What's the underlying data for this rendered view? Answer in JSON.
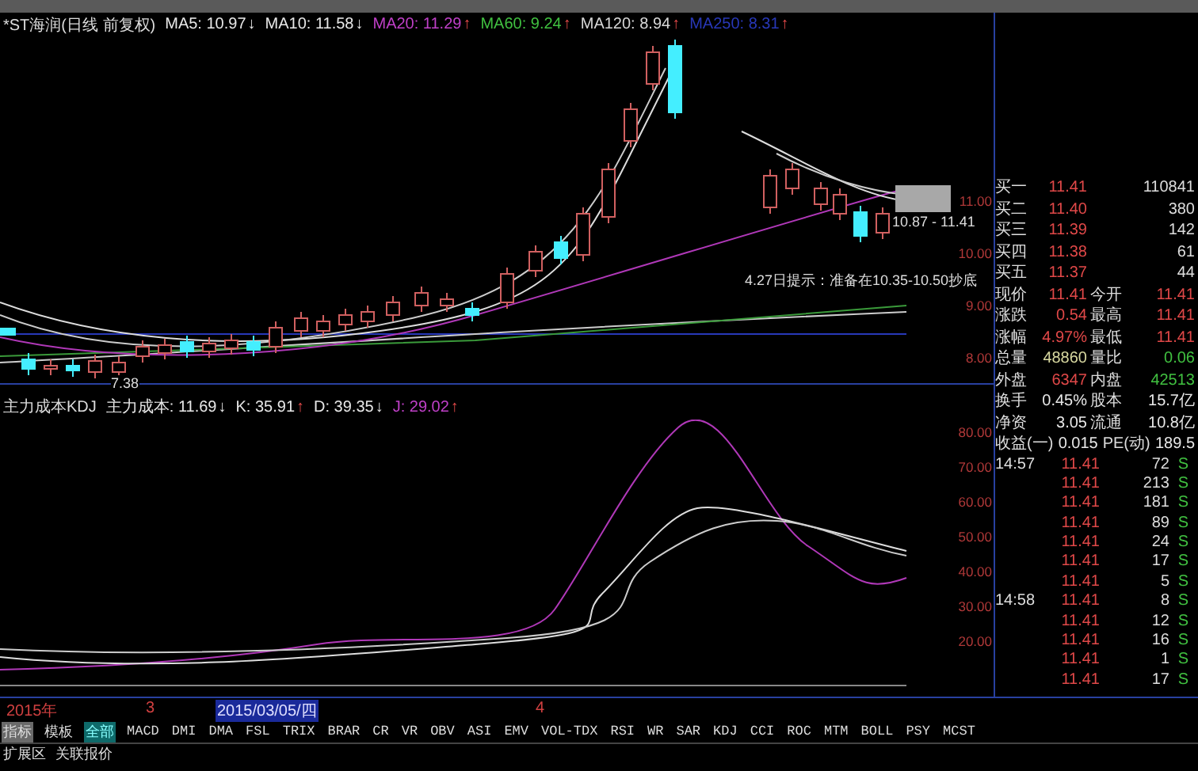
{
  "legend": {
    "title": "*ST海润(日线 前复权)",
    "items": [
      {
        "label": "MA5: 10.97",
        "color": "#e8e8e8",
        "arrow": "↓",
        "rising": false
      },
      {
        "label": "MA10: 11.58",
        "color": "#e8e8e8",
        "arrow": "↓",
        "rising": false
      },
      {
        "label": "MA20: 11.29",
        "color": "#c040c8",
        "arrow": "↑",
        "rising": true
      },
      {
        "label": "MA60: 9.24",
        "color": "#40c040",
        "arrow": "↑",
        "rising": true
      },
      {
        "label": "MA120: 8.94",
        "color": "#d8d8d8",
        "arrow": "↑",
        "rising": true
      },
      {
        "label": "MA250: 8.31",
        "color": "#2838b8",
        "arrow": "↑",
        "rising": true
      }
    ]
  },
  "main_chart": {
    "axis_labels": [
      "11.00",
      "10.00",
      "9.00",
      "8.00"
    ],
    "low_label": "7.38",
    "range_label": "10.87 - 11.41",
    "note": "4.27日提示：准备在10.35-10.50抄底"
  },
  "kdj_legend": {
    "title": "主力成本KDJ",
    "items": [
      {
        "label": "主力成本: 11.69",
        "color": "#e8e8e8",
        "arrow": "↓",
        "rising": false
      },
      {
        "label": "K: 35.91",
        "color": "#e8e8e8",
        "arrow": "↑",
        "rising": true
      },
      {
        "label": "D: 39.35",
        "color": "#e8e8e8",
        "arrow": "↓",
        "rising": false
      },
      {
        "label": "J: 29.02",
        "color": "#c040c8",
        "arrow": "↑",
        "rising": true
      }
    ]
  },
  "kdj_chart": {
    "axis_labels": [
      "80.00",
      "70.00",
      "60.00",
      "50.00",
      "40.00",
      "30.00",
      "20.00"
    ]
  },
  "order_book": [
    {
      "label": "买一",
      "price": "11.41",
      "volume": "110841"
    },
    {
      "label": "买二",
      "price": "11.40",
      "volume": "380"
    },
    {
      "label": "买三",
      "price": "11.39",
      "volume": "142"
    },
    {
      "label": "买四",
      "price": "11.38",
      "volume": "61"
    },
    {
      "label": "买五",
      "price": "11.37",
      "volume": "44"
    }
  ],
  "stats": [
    {
      "cells": [
        {
          "label": "现价",
          "value": "11.41",
          "color": "#e04848"
        },
        {
          "label": "今开",
          "value": "11.41",
          "color": "#e04848"
        }
      ]
    },
    {
      "cells": [
        {
          "label": "涨跌",
          "value": "0.54",
          "color": "#e04848"
        },
        {
          "label": "最高",
          "value": "11.41",
          "color": "#e04848"
        }
      ]
    },
    {
      "cells": [
        {
          "label": "涨幅",
          "value": "4.97%",
          "color": "#e04848"
        },
        {
          "label": "最低",
          "value": "11.41",
          "color": "#e04848"
        }
      ]
    },
    {
      "cells": [
        {
          "label": "总量",
          "value": "48860",
          "color": "#d8d8a0"
        },
        {
          "label": "量比",
          "value": "0.06",
          "color": "#40c040"
        }
      ]
    },
    {
      "cells": [
        {
          "label": "外盘",
          "value": "6347",
          "color": "#e04848"
        },
        {
          "label": "内盘",
          "value": "42513",
          "color": "#40c040"
        }
      ]
    },
    {
      "cells": [
        {
          "label": "换手",
          "value": "0.45%",
          "color": "#e8e8e8"
        },
        {
          "label": "股本",
          "value": "15.7亿",
          "color": "#e8e8e8"
        }
      ]
    },
    {
      "cells": [
        {
          "label": "净资",
          "value": "3.05",
          "color": "#e8e8e8"
        },
        {
          "label": "流通",
          "value": "10.8亿",
          "color": "#e8e8e8"
        }
      ]
    },
    {
      "cells": [
        {
          "label": "收益(一)",
          "value": "0.015",
          "color": "#e8e8e8"
        },
        {
          "label": "PE(动)",
          "value": "189.5",
          "color": "#e8e8e8"
        }
      ]
    }
  ],
  "ticks": [
    {
      "time": "14:57",
      "price": "11.41",
      "volume": "72",
      "side": "S"
    },
    {
      "price": "11.41",
      "volume": "213",
      "side": "S"
    },
    {
      "price": "11.41",
      "volume": "181",
      "side": "S"
    },
    {
      "price": "11.41",
      "volume": "89",
      "side": "S"
    },
    {
      "price": "11.41",
      "volume": "24",
      "side": "S"
    },
    {
      "price": "11.41",
      "volume": "17",
      "side": "S"
    },
    {
      "price": "11.41",
      "volume": "5",
      "side": "S"
    },
    {
      "time": "14:58",
      "price": "11.41",
      "volume": "8",
      "side": "S"
    },
    {
      "price": "11.41",
      "volume": "12",
      "side": "S"
    },
    {
      "price": "11.41",
      "volume": "16",
      "side": "S"
    },
    {
      "price": "11.41",
      "volume": "1",
      "side": "S"
    },
    {
      "price": "11.41",
      "volume": "17",
      "side": "S"
    }
  ],
  "date_axis": [
    {
      "label": "2015年",
      "kind": "period"
    },
    {
      "label": "3",
      "kind": "period"
    },
    {
      "label": "2015/03/05/四",
      "kind": "cursor"
    },
    {
      "label": "4",
      "kind": "period"
    }
  ],
  "mode_tabs": [
    {
      "label": "指标",
      "selected": true
    },
    {
      "label": "模板",
      "selected": false
    }
  ],
  "indicator_tabs": [
    {
      "label": "全部",
      "selected": true
    },
    {
      "label": "MACD",
      "selected": false
    },
    {
      "label": "DMI",
      "selected": false
    },
    {
      "label": "DMA",
      "selected": false
    },
    {
      "label": "FSL",
      "selected": false
    },
    {
      "label": "TRIX",
      "selected": false
    },
    {
      "label": "BRAR",
      "selected": false
    },
    {
      "label": "CR",
      "selected": false
    },
    {
      "label": "VR",
      "selected": false
    },
    {
      "label": "OBV",
      "selected": false
    },
    {
      "label": "ASI",
      "selected": false
    },
    {
      "label": "EMV",
      "selected": false
    },
    {
      "label": "VOL-TDX",
      "selected": false
    },
    {
      "label": "RSI",
      "selected": false
    },
    {
      "label": "WR",
      "selected": false
    },
    {
      "label": "SAR",
      "selected": false
    },
    {
      "label": "KDJ",
      "selected": false
    },
    {
      "label": "CCI",
      "selected": false
    },
    {
      "label": "ROC",
      "selected": false
    },
    {
      "label": "MTM",
      "selected": false
    },
    {
      "label": "BOLL",
      "selected": false
    },
    {
      "label": "PSY",
      "selected": false
    },
    {
      "label": "MCST",
      "selected": false
    }
  ],
  "bottom_tabs": [
    "扩展区",
    "关联报价"
  ]
}
